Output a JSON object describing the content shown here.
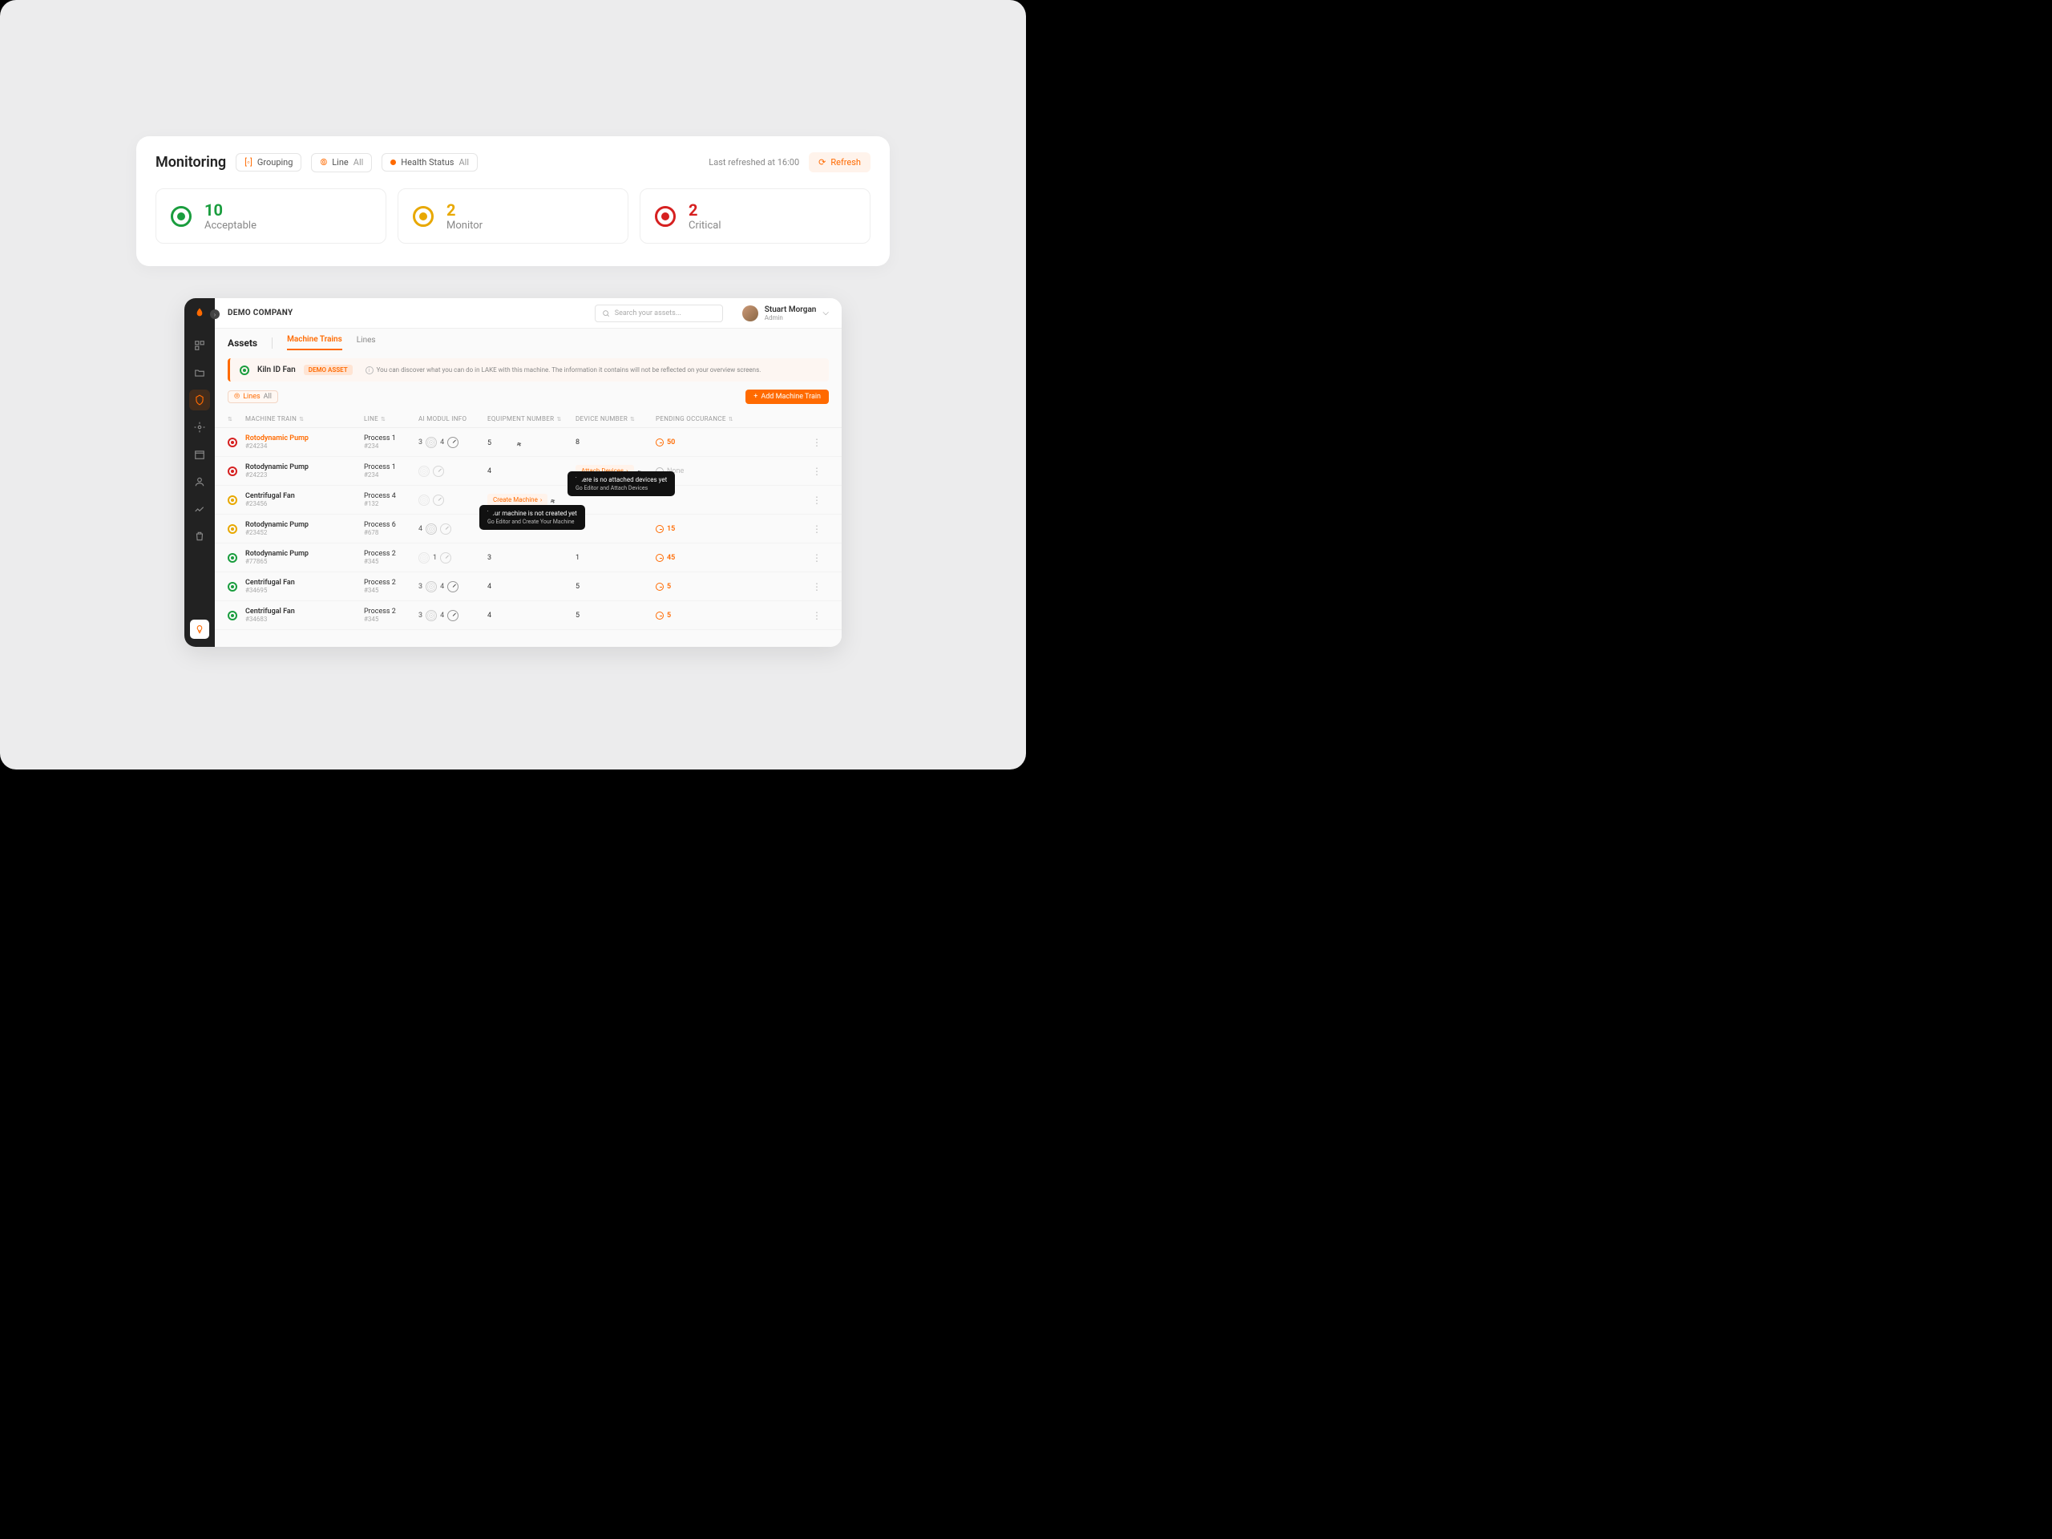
{
  "monitoring": {
    "title": "Monitoring",
    "grouping_label": "Grouping",
    "line_label": "Line",
    "health_label": "Health Status",
    "all": "All",
    "timestamp": "Last refreshed at 16:00",
    "refresh": "Refresh",
    "cards": [
      {
        "count": "10",
        "label": "Acceptable",
        "color": "green"
      },
      {
        "count": "2",
        "label": "Monitor",
        "color": "yellow"
      },
      {
        "count": "2",
        "label": "Critical",
        "color": "red"
      }
    ]
  },
  "app": {
    "company": "DEMO COMPANY",
    "search_placeholder": "Search your assets...",
    "user": {
      "name": "Stuart Morgan",
      "role": "Admin"
    },
    "assets_title": "Assets",
    "tabs": [
      {
        "label": "Machine Trains",
        "active": true
      },
      {
        "label": "Lines",
        "active": false
      }
    ],
    "banner": {
      "title": "Kiln ID Fan",
      "badge": "DEMO ASSET",
      "text": "You can discover what you can do in LAKE with this machine. The information it contains will not be reflected on your overview screens."
    },
    "lines_filter": {
      "label": "Lines",
      "value": "All"
    },
    "add_btn": "Add Machine Train",
    "columns": {
      "machine": "MACHINE TRAIN",
      "line": "LINE",
      "ai": "AI MODUL INFO",
      "equip": "EQUIPMENT NUMBER",
      "device": "DEVICE NUMBER",
      "pending": "PENDING OCCURANCE"
    },
    "rows": [
      {
        "dot": "red",
        "name": "Rotodynamic Pump",
        "link": true,
        "id": "#24234",
        "line": "Process 1",
        "lineId": "#234",
        "ai1": "3",
        "ai2": "4",
        "aiFaded": false,
        "equip": "5",
        "device": "8",
        "pending": "50",
        "pendType": "num"
      },
      {
        "dot": "red",
        "name": "Rotodynamic Pump",
        "link": false,
        "id": "#24223",
        "line": "Process 1",
        "lineId": "#234",
        "ai1": "",
        "ai2": "",
        "aiFaded": true,
        "equip": "4",
        "deviceTag": "Attach Devices",
        "pendType": "none",
        "pending": "None"
      },
      {
        "dot": "yellow",
        "name": "Centrifugal Fan",
        "link": false,
        "id": "#23456",
        "line": "Process 4",
        "lineId": "#132",
        "ai1": "",
        "ai2": "",
        "aiFaded": true,
        "equipTag": "Create Machine",
        "pendType": "empty"
      },
      {
        "dot": "yellow",
        "name": "Rotodynamic Pump",
        "link": false,
        "id": "#23452",
        "line": "Process 6",
        "lineId": "#678",
        "ai1": "4",
        "ai2": "",
        "aiFaded": false,
        "gaugeFaded": true,
        "equip": "",
        "device": "",
        "pending": "15",
        "pendType": "num"
      },
      {
        "dot": "green",
        "name": "Rotodynamic Pump",
        "link": false,
        "id": "#77865",
        "line": "Process 2",
        "lineId": "#345",
        "ai1": "",
        "ai2": "1",
        "aiFaded": true,
        "ai1Faded": true,
        "equip": "3",
        "device": "1",
        "pending": "45",
        "pendType": "num"
      },
      {
        "dot": "green",
        "name": "Centrifugal Fan",
        "link": false,
        "id": "#34695",
        "line": "Process 2",
        "lineId": "#345",
        "ai1": "3",
        "ai2": "4",
        "aiFaded": false,
        "equip": "4",
        "device": "5",
        "pending": "5",
        "pendType": "num"
      },
      {
        "dot": "green",
        "name": "Centrifugal Fan",
        "link": false,
        "id": "#34683",
        "line": "Process 2",
        "lineId": "#345",
        "ai1": "3",
        "ai2": "4",
        "aiFaded": false,
        "equip": "4",
        "device": "5",
        "pending": "5",
        "pendType": "num"
      }
    ],
    "tooltips": {
      "create": {
        "t": "Your machine is not created yet",
        "s": "Go Editor and Create Your Machine"
      },
      "attach": {
        "t": "There is no attached devices yet",
        "s": "Go Editor and Attach Devices"
      }
    }
  }
}
